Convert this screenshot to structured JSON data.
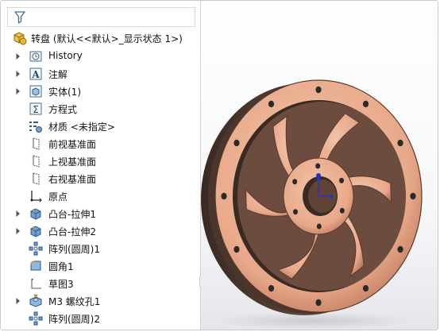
{
  "tree": {
    "filter_icon": "funnel-icon",
    "root": {
      "icon": "part-icon",
      "label": "转盘  (默认<<默认>_显示状态 1>)"
    },
    "items": [
      {
        "name": "history",
        "icon": "history-icon",
        "label": "History",
        "expandable": true
      },
      {
        "name": "annotations",
        "icon": "annotation-icon",
        "label": "注解",
        "expandable": true
      },
      {
        "name": "solid-bodies",
        "icon": "solid-body-icon",
        "label": "实体(1)",
        "expandable": true
      },
      {
        "name": "equations",
        "icon": "equation-icon",
        "label": "方程式",
        "expandable": false
      },
      {
        "name": "material",
        "icon": "material-icon",
        "label": "材质 <未指定>",
        "expandable": false
      },
      {
        "name": "front-plane",
        "icon": "plane-icon",
        "label": "前视基准面",
        "expandable": false
      },
      {
        "name": "top-plane",
        "icon": "plane-icon",
        "label": "上视基准面",
        "expandable": false
      },
      {
        "name": "right-plane",
        "icon": "plane-icon",
        "label": "右视基准面",
        "expandable": false
      },
      {
        "name": "origin",
        "icon": "origin-icon",
        "label": "原点",
        "expandable": false
      },
      {
        "name": "boss-extrude-1",
        "icon": "boss-extrude-icon",
        "label": "凸台-拉伸1",
        "expandable": true
      },
      {
        "name": "boss-extrude-2",
        "icon": "boss-extrude-icon",
        "label": "凸台-拉伸2",
        "expandable": true
      },
      {
        "name": "circular-pattern-1",
        "icon": "circular-pattern-icon",
        "label": "阵列(圆周)1",
        "expandable": false
      },
      {
        "name": "fillet-1",
        "icon": "fillet-icon",
        "label": "圆角1",
        "expandable": false
      },
      {
        "name": "sketch-3",
        "icon": "sketch-icon",
        "label": "草图3",
        "expandable": false
      },
      {
        "name": "hole-wizard",
        "icon": "hole-wizard-icon",
        "label": "M3 螺纹孔1",
        "expandable": true
      },
      {
        "name": "circular-pattern-2",
        "icon": "circular-pattern-icon",
        "label": "阵列(圆周)2",
        "expandable": false
      }
    ]
  },
  "viewport": {
    "model": "turntable-wheel-3d-model",
    "colors": {
      "wood": "#e8a98a",
      "wood_dark": "#b77055",
      "rim_shadow": "#5b4338",
      "hole": "#2a2a2a",
      "axis_blue": "#2233cc"
    }
  }
}
